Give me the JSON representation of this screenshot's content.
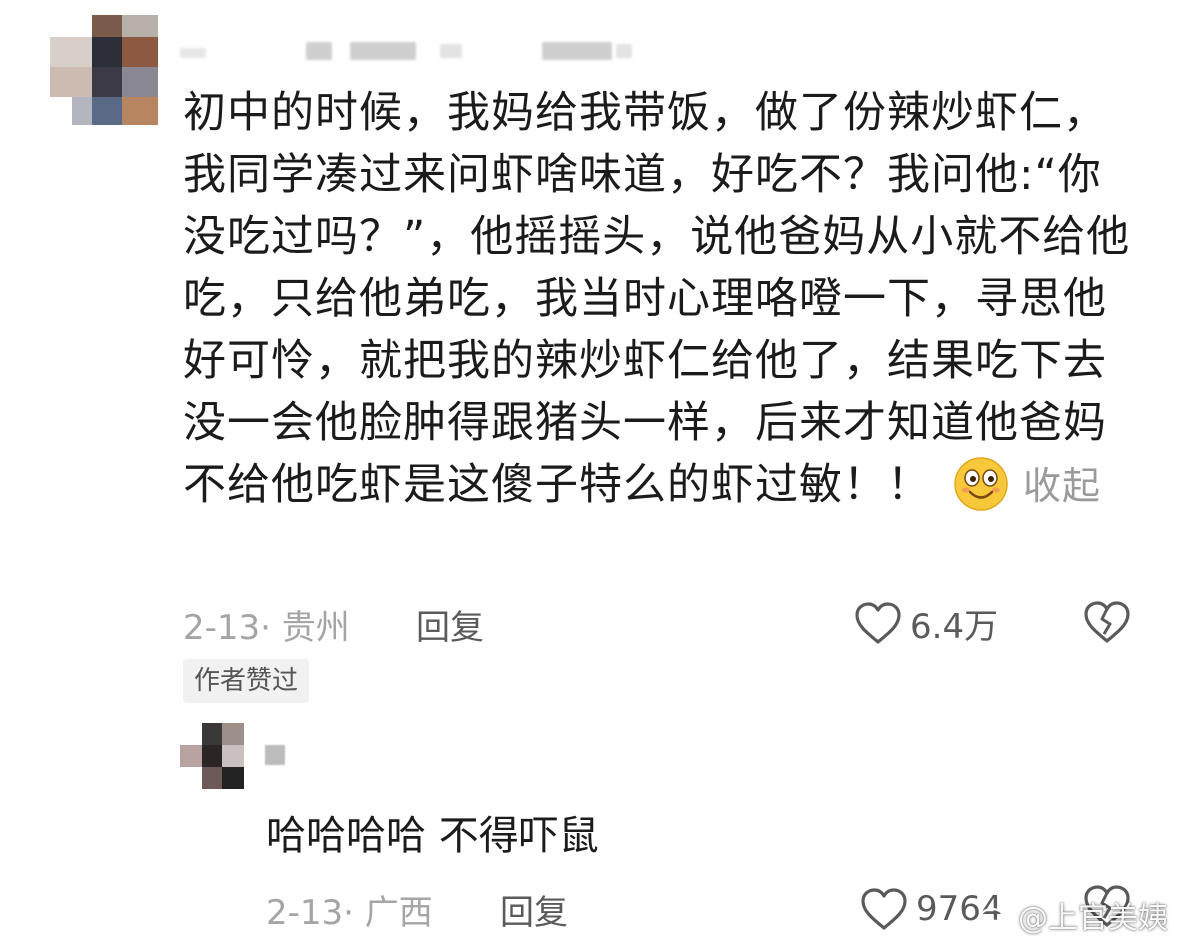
{
  "comment": {
    "lines": [
      "初中的时候，我妈给我带饭，做了份辣炒虾仁，",
      "我同学凑过来问虾啥味道，好吃不？我问他:“你",
      "没吃过吗？”，他摇摇头，说他爸妈从小就不给他",
      "吃，只给他弟吃，我当时心理咯噔一下，寻思他",
      "好可怜，就把我的辣炒虾仁给他了，结果吃下去",
      "没一会他脸肿得跟猪头一样，后来才知道他爸妈",
      "不给他吃虾是这傻子特么的虾过敏！！"
    ],
    "collapse_label": "收起",
    "date_location": "2-13· 贵州",
    "reply_label": "回复",
    "like_count": "6.4万",
    "author_liked_badge": "作者赞过"
  },
  "reply_comment": {
    "text": "哈哈哈哈 不得吓鼠",
    "date_location": "2-13· 广西",
    "reply_label": "回复",
    "like_count": "9764"
  },
  "watermark": {
    "text": "@上官美姨"
  },
  "icons": {
    "heart": "heart-outline-icon",
    "dislike": "broken-heart-icon",
    "emoji": "smiling-face-icon",
    "weibo": "weibo-logo-icon"
  },
  "colors": {
    "text": "#1b1b1b",
    "meta": "#a5a5a5",
    "secondary": "#5a5a5a",
    "badge_bg": "#f1f1f1",
    "emoji_yellow": "#f6c83a"
  }
}
